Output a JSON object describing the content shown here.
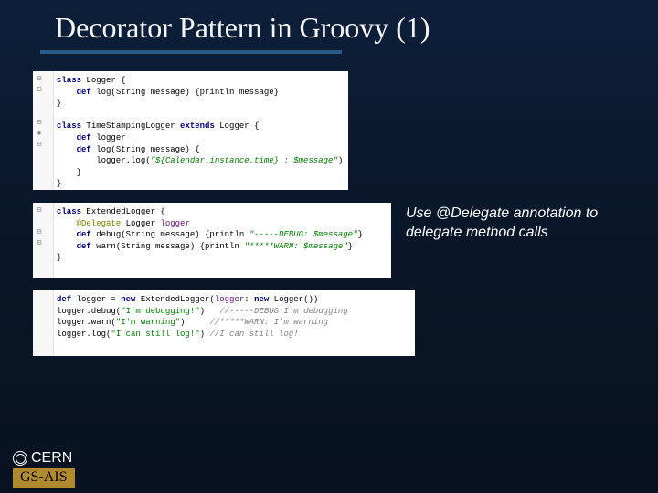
{
  "slide": {
    "title": "Decorator Pattern in Groovy (1)"
  },
  "callout": {
    "text": "Use @Delegate annotation to delegate method calls"
  },
  "footer": {
    "org": "CERN",
    "dept": "GS-AIS"
  },
  "code1": {
    "l1a": "class",
    "l1b": " Logger {",
    "l2a": "    def",
    "l2b": " log(String message) {println message}",
    "l3": "}",
    "l4": "",
    "l5a": "class",
    "l5b": " TimeStampingLogger ",
    "l5c": "extends",
    "l5d": " Logger {",
    "l6a": "    def",
    "l6b": " logger",
    "l7a": "    def",
    "l7b": " log(String message) {",
    "l8a": "        logger.log(",
    "l8b": "\"${Calendar.instance.time} : $message\"",
    "l8c": ")",
    "l9": "    }",
    "l10": "}"
  },
  "code2": {
    "l1a": "class",
    "l1b": " ExtendedLogger {",
    "l2a": "    @Delegate",
    "l2b": " Logger ",
    "l2c": "logger",
    "l3a": "    def",
    "l3b": " debug(String message) {println ",
    "l3c": "\"-----DEBUG: $message\"",
    "l3d": "}",
    "l4a": "    def",
    "l4b": " warn(String message) {println ",
    "l4c": "\"*****WARN: $message\"",
    "l4d": "}",
    "l5": "}"
  },
  "code3": {
    "l1a": "def",
    "l1b": " logger = ",
    "l1c": "new",
    "l1d": " ExtendedLogger(",
    "l1e": "logger",
    "l1f": ": ",
    "l1g": "new",
    "l1h": " Logger())",
    "l2a": "logger.debug(",
    "l2b": "\"I'm debugging!\"",
    "l2c": ")   ",
    "l2d": "//-----DEBUG:I'm debugging",
    "l3a": "logger.warn(",
    "l3b": "\"I'm warning\"",
    "l3c": ")     ",
    "l3d": "//*****WARN: I'm warning",
    "l4a": "logger.log(",
    "l4b": "\"I can still log!\"",
    "l4c": ") ",
    "l4d": "//I can still log!"
  }
}
